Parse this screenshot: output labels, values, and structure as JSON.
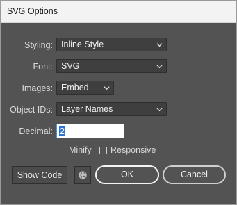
{
  "window": {
    "title": "SVG Options"
  },
  "form": {
    "styling": {
      "label": "Styling:",
      "value": "Inline Style"
    },
    "font": {
      "label": "Font:",
      "value": "SVG"
    },
    "images": {
      "label": "Images:",
      "value": "Embed"
    },
    "object_ids": {
      "label": "Object IDs:",
      "value": "Layer Names"
    },
    "decimal": {
      "label": "Decimal:",
      "value": "2"
    },
    "minify": {
      "label": "Minify",
      "checked": false
    },
    "responsive": {
      "label": "Responsive",
      "checked": false
    }
  },
  "buttons": {
    "show_code": "Show Code",
    "web_preview_icon": "globe-icon",
    "ok": "OK",
    "cancel": "Cancel"
  },
  "colors": {
    "dialog_bg": "#535353",
    "field_bg": "#3f3f3f",
    "selection": "#2b74d6"
  }
}
